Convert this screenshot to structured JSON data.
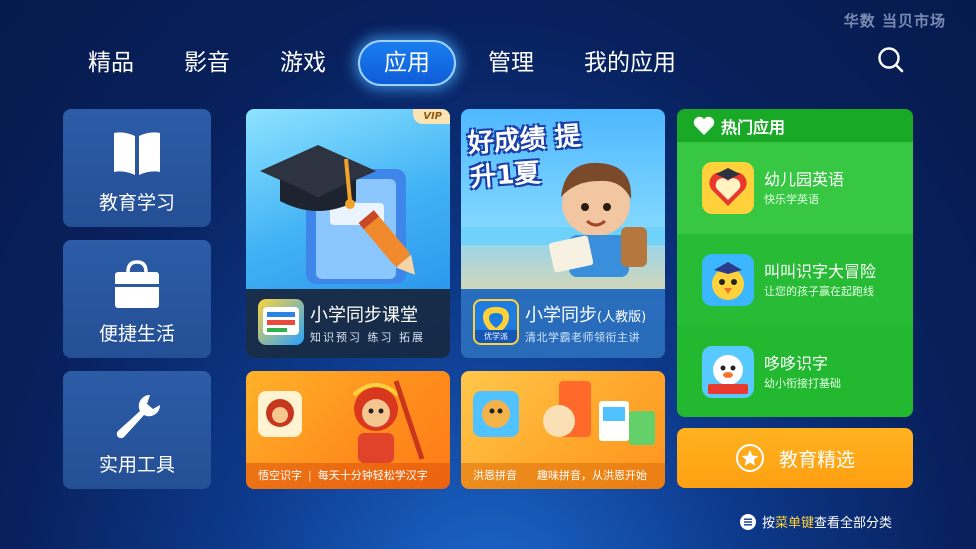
{
  "brand": "华数 当贝市场",
  "nav": {
    "tabs": [
      {
        "label": "精品"
      },
      {
        "label": "影音"
      },
      {
        "label": "游戏"
      },
      {
        "label": "应用",
        "active": true
      },
      {
        "label": "管理"
      },
      {
        "label": "我的应用"
      }
    ],
    "search_icon": "search-icon"
  },
  "categories": [
    {
      "label": "教育学习",
      "icon": "book-icon"
    },
    {
      "label": "便捷生活",
      "icon": "bag-icon"
    },
    {
      "label": "实用工具",
      "icon": "wrench-icon"
    }
  ],
  "featured": [
    {
      "title": "小学同步课堂",
      "subtitle": "知识预习 练习 拓展",
      "badge": "VIP"
    },
    {
      "title": "小学同步",
      "title_suffix": "(人教版)",
      "subtitle": "清北学霸老师领衔主讲",
      "banner_text": "好成绩 提升1夏",
      "logo_text": "优学派"
    },
    {
      "title": "悟空识字",
      "subtitle": "每天十分钟轻松学汉字"
    },
    {
      "title": "洪恩拼音",
      "subtitle": "趣味拼音，从洪恩开始"
    }
  ],
  "hot_apps": {
    "header": "热门应用",
    "items": [
      {
        "name": "幼儿园英语",
        "desc": "快乐学英语"
      },
      {
        "name": "叫叫识字大冒险",
        "desc": "让您的孩子赢在起跑线"
      },
      {
        "name": "哆哆识字",
        "desc": "幼小衔接打基础"
      }
    ]
  },
  "edu_button": {
    "label": "教育精选",
    "icon": "star-icon"
  },
  "hint": {
    "prefix": "按",
    "key": "菜单键",
    "suffix": "查看全部分类"
  },
  "colors": {
    "accent": "#1a7df0",
    "hot_green": "#22b830",
    "edu_orange": "#ffa617",
    "tile_blue": "#2a58a2"
  }
}
